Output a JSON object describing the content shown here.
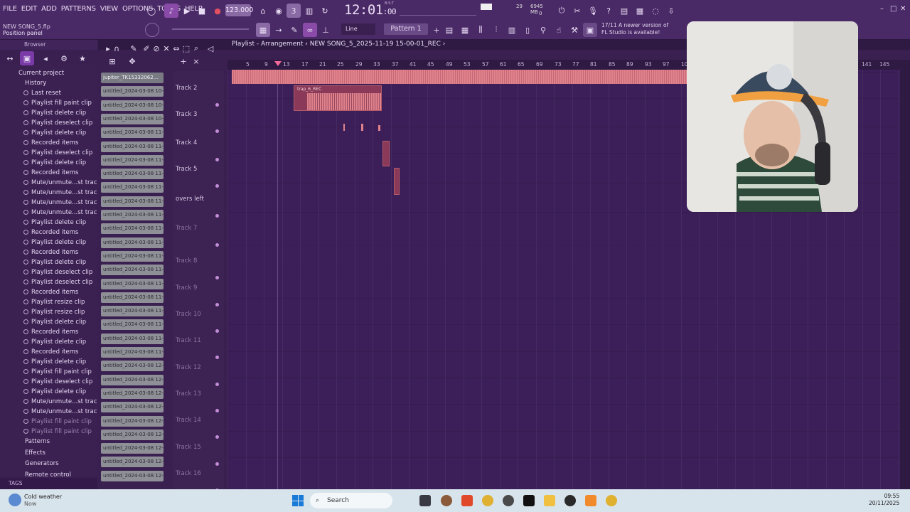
{
  "menu": [
    "FILE",
    "EDIT",
    "ADD",
    "PATTERNS",
    "VIEW",
    "OPTIONS",
    "TOOLS",
    "HELP"
  ],
  "transport": {
    "tempo": "123.000",
    "time_main": "12:01",
    "time_sub": ":00",
    "time_top": "B:S:T"
  },
  "cpu": {
    "ram": "6945 MB",
    "polyphony": "0",
    "cpu_pct": "29"
  },
  "title": {
    "file": "NEW SONG_5.flp",
    "hint": "Position panel"
  },
  "toolbar2": {
    "snap": "Line",
    "pattern": "Pattern 1"
  },
  "update_notice": {
    "count": "17/11",
    "text1": "A newer version of",
    "text2": "FL Studio is available!"
  },
  "browser": {
    "header": "Browser",
    "current_project": "Current project",
    "history": "History",
    "history_items": [
      "Last reset",
      "Playlist fill paint clip",
      "Playlist delete clip",
      "Playlist deselect clip",
      "Playlist delete clip",
      "Recorded items",
      "Playlist deselect clip",
      "Playlist delete clip",
      "Recorded items",
      "Mute/unmute...st track(s)",
      "Mute/unmute...st track(s)",
      "Mute/unmute...st track(s)",
      "Mute/unmute...st track(s)",
      "Playlist delete clip",
      "Recorded items",
      "Playlist delete clip",
      "Recorded items",
      "Playlist delete clip",
      "Playlist deselect clip",
      "Playlist deselect clip",
      "Recorded items",
      "Playlist resize clip",
      "Playlist resize clip",
      "Playlist delete clip",
      "Recorded items",
      "Playlist delete clip",
      "Recorded items",
      "Playlist delete clip",
      "Playlist fill paint clip",
      "Playlist deselect clip",
      "Playlist delete clip",
      "Mute/unmute...st track(s)",
      "Mute/unmute...st track(s)",
      "Playlist fill paint clip",
      "Playlist fill paint clip"
    ],
    "folders": [
      "Patterns",
      "Effects",
      "Generators",
      "Remote control"
    ],
    "tags": "TAGS"
  },
  "playlist": {
    "title": "Playlist - Arrangement",
    "breadcrumb": "NEW SONG_5_2025-11-19 15-00-01_REC",
    "clip_label": "trap_6_REC",
    "picker_items": [
      "jupiter_TK15332062...",
      "untitled_2024-03-08 10-...",
      "untitled_2024-03-08 10-...",
      "untitled_2024-03-08 10-...",
      "untitled_2024-03-08 11-...",
      "untitled_2024-03-08 11-...",
      "untitled_2024-03-08 11-...",
      "untitled_2024-03-08 11-...",
      "untitled_2024-03-08 11-...",
      "untitled_2024-03-08 11-...",
      "untitled_2024-03-08 11-...",
      "untitled_2024-03-08 11-...",
      "untitled_2024-03-08 11-...",
      "untitled_2024-03-08 11-...",
      "untitled_2024-03-08 11-...",
      "untitled_2024-03-08 11-...",
      "untitled_2024-03-08 11-...",
      "untitled_2024-03-08 11-...",
      "untitled_2024-03-08 11-...",
      "untitled_2024-03-08 11-...",
      "untitled_2024-03-08 11-...",
      "untitled_2024-03-08 12-...",
      "untitled_2024-03-08 12-...",
      "untitled_2024-03-08 12-...",
      "untitled_2024-03-08 12-...",
      "untitled_2024-03-08 12-...",
      "untitled_2024-03-08 12-...",
      "untitled_2024-03-08 12-...",
      "untitled_2024-03-08 12-...",
      "untitled_2024-03-08 12-..."
    ],
    "tracks": [
      {
        "name": "Track 2",
        "dim": false
      },
      {
        "name": "Track 3",
        "dim": false
      },
      {
        "name": "Track 4",
        "dim": false
      },
      {
        "name": "Track 5",
        "dim": false
      },
      {
        "name": "overs left",
        "dim": false
      },
      {
        "name": "Track 7",
        "dim": true
      },
      {
        "name": "Track 8",
        "dim": true
      },
      {
        "name": "Track 9",
        "dim": true
      },
      {
        "name": "Track 10",
        "dim": true
      },
      {
        "name": "Track 11",
        "dim": true
      },
      {
        "name": "Track 12",
        "dim": true
      },
      {
        "name": "Track 13",
        "dim": true
      },
      {
        "name": "Track 14",
        "dim": true
      },
      {
        "name": "Track 15",
        "dim": true
      },
      {
        "name": "Track 16",
        "dim": true
      }
    ],
    "bar_ticks": [
      "5",
      "9",
      "13",
      "17",
      "21",
      "25",
      "29",
      "33",
      "37",
      "41",
      "45",
      "49",
      "53",
      "57",
      "61",
      "65",
      "69",
      "73",
      "77",
      "81",
      "85",
      "89",
      "93",
      "97",
      "101",
      "141",
      "145"
    ]
  },
  "taskbar": {
    "weather_title": "Cold weather",
    "weather_sub": "Now",
    "search": "Search",
    "time": "09:55",
    "date": "20/11/2025"
  },
  "colors": {
    "bg": "#3c1f58",
    "accent": "#e0828c",
    "panel": "#4a2a66"
  }
}
